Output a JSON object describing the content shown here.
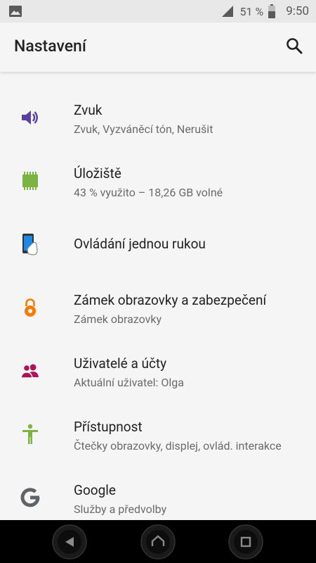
{
  "status": {
    "signal_icon": "signal-no-data-icon",
    "battery_text": "51 %",
    "time": "9:50"
  },
  "appbar": {
    "title": "Nastavení",
    "search_icon": "search-icon"
  },
  "items": [
    {
      "title": "Zvuk",
      "subtitle": "Zvuk, Vyzváněcí tón, Nerušit",
      "icon": "volume-icon",
      "color": "#5a3fa6"
    },
    {
      "title": "Úložiště",
      "subtitle": "43 % využito – 18,26 GB volné",
      "icon": "storage-chip-icon",
      "color": "#7cb342"
    },
    {
      "title": "Ovládání jednou rukou",
      "subtitle": "",
      "icon": "one-hand-phone-icon",
      "color": "#1e88e5"
    },
    {
      "title": "Zámek obrazovky a zabezpečení",
      "subtitle": "Zámek obrazovky",
      "icon": "lock-icon",
      "color": "#f57c00"
    },
    {
      "title": "Uživatelé a účty",
      "subtitle": "Aktuální uživatel: Olga",
      "icon": "users-icon",
      "color": "#ad1457"
    },
    {
      "title": "Přístupnost",
      "subtitle": "Čtečky obrazovky, displej, ovlád. interakce",
      "icon": "accessibility-icon",
      "color": "#7cb342"
    },
    {
      "title": "Google",
      "subtitle": "Služby a předvolby",
      "icon": "google-icon",
      "color": "#5f6368"
    }
  ],
  "nav": {
    "back_icon": "back-triangle-icon",
    "home_icon": "home-icon",
    "recents_icon": "recents-square-icon"
  }
}
